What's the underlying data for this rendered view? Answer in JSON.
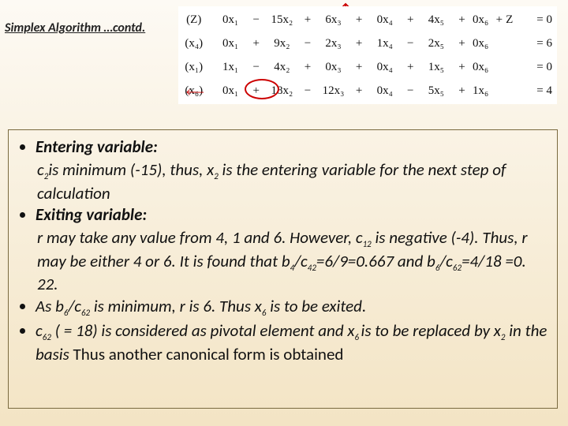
{
  "title": "Simplex Algorithm …contd.",
  "tableau": {
    "r0": {
      "basis": "(Z)",
      "c1": "0x₁",
      "s1": "−",
      "c2": "15x₂",
      "s2": "+",
      "c3": "6x₃",
      "s3": "+",
      "c4": "0x₄",
      "s4": "+",
      "c5": "4x₅",
      "s5": "+",
      "c6": "0x₆",
      "s6": "+",
      "z": "Z",
      "eq": "= 0"
    },
    "r1": {
      "basis": "(x₄)",
      "c1": "0x₁",
      "s1": "+",
      "c2": "9x₂",
      "s2": "−",
      "c3": "2x₃",
      "s3": "+",
      "c4": "1x₄",
      "s4": "−",
      "c5": "2x₅",
      "s5": "+",
      "c6": "0x₆",
      "s6": "",
      "z": "",
      "eq": "= 6"
    },
    "r2": {
      "basis": "(x₁)",
      "c1": "1x₁",
      "s1": "−",
      "c2": "4x₂",
      "s2": "+",
      "c3": "0x₃",
      "s3": "+",
      "c4": "0x₄",
      "s4": "+",
      "c5": "1x₅",
      "s5": "+",
      "c6": "0x₆",
      "s6": "",
      "z": "",
      "eq": "= 0"
    },
    "r3": {
      "basis": "(x₆)",
      "c1": "0x₁",
      "s1": "+",
      "c2": "18x₂",
      "s2": "−",
      "c3": "12x₃",
      "s3": "+",
      "c4": "0x₄",
      "s4": "−",
      "c5": "5x₅",
      "s5": "+",
      "c6": "1x₆",
      "s6": "",
      "z": "",
      "eq": "= 4"
    }
  },
  "bul": {
    "b1_head": "Entering variable:",
    "b1_body_a": "c",
    "b1_body_a2": "2",
    "b1_body_b": "is minimum (-15), thus, x",
    "b1_body_b2": "2",
    "b1_body_c": " is the entering variable for the next step of calculation",
    "b2_head": "Exiting variable:",
    "b2_body_a": "r may take any value from 4, 1 and 6. However, c",
    "b2_body_a2": "12",
    "b2_body_b": " is negative (-4). Thus, r may be either 4 or 6. It is found that b",
    "b2_body_b2": "4",
    "b2_body_c": "/c",
    "b2_body_c2": "42",
    "b2_body_d": "=6/9=0.667 and b",
    "b2_body_d2": "6",
    "b2_body_e": "/c",
    "b2_body_e2": "62",
    "b2_body_f": "=4/18 =0. 22.",
    "b3_a": "As b",
    "b3_a2": "6",
    "b3_b": "/c",
    "b3_b2": "62",
    "b3_c": " is minimum, r is 6. Thus x",
    "b3_c2": "6",
    "b3_d": " is to be exited.",
    "b4_a": "c",
    "b4_a2": "62",
    "b4_b": " ( = 18) is considered as pivotal element and x",
    "b4_b2": "6 ",
    "b4_c": "is to be replaced by x",
    "b4_c2": "2",
    "b4_d": " in the basis ",
    "b4_e": "Thus another canonical form is obtained"
  }
}
